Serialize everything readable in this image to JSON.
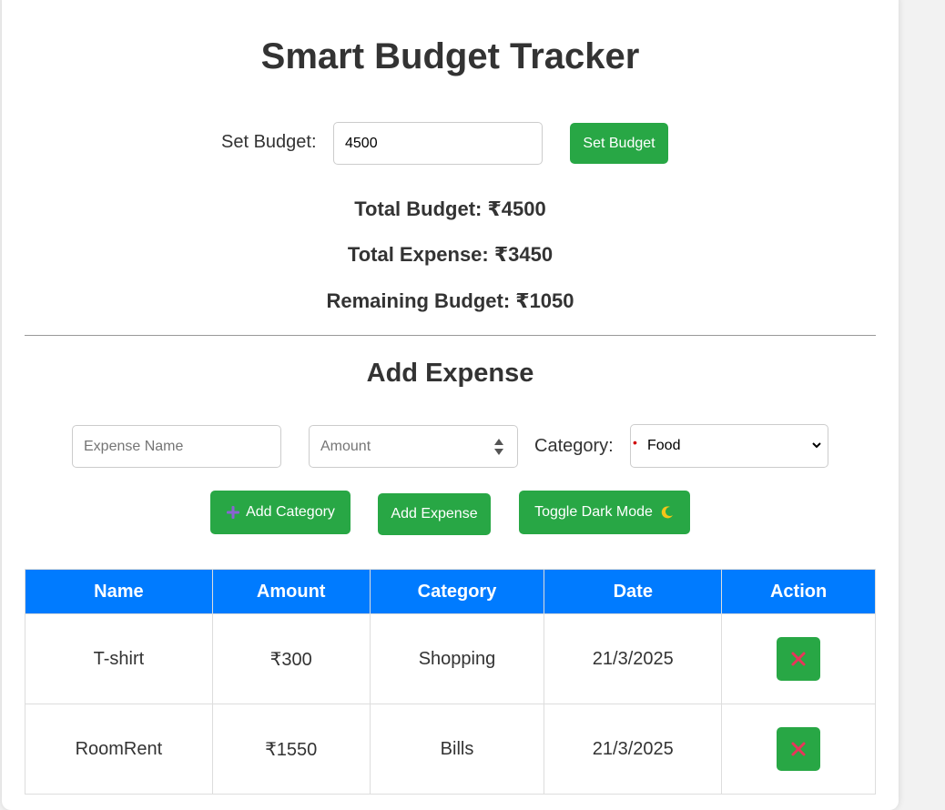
{
  "app": {
    "title": "Smart Budget Tracker"
  },
  "budget": {
    "label": "Set Budget:",
    "input_value": "4500",
    "button_label": "Set Budget"
  },
  "summary": {
    "total_budget": "Total Budget: ₹4500",
    "total_expense": "Total Expense: ₹3450",
    "remaining_budget": "Remaining Budget: ₹1050"
  },
  "add_expense": {
    "heading": "Add Expense",
    "name_placeholder": "Expense Name",
    "amount_placeholder": "Amount",
    "category_label": "Category:",
    "category_selected": "Food",
    "add_category_label": "Add Category",
    "add_expense_label": "Add Expense",
    "toggle_dark_label": "Toggle Dark Mode"
  },
  "table": {
    "headers": [
      "Name",
      "Amount",
      "Category",
      "Date",
      "Action"
    ],
    "rows": [
      {
        "name": "T-shirt",
        "amount": "₹300",
        "category": "Shopping",
        "date": "21/3/2025"
      },
      {
        "name": "RoomRent",
        "amount": "₹1550",
        "category": "Bills",
        "date": "21/3/2025"
      }
    ]
  },
  "colors": {
    "primary_button": "#28a745",
    "table_header": "#007bff",
    "delete_icon": "#e8355a",
    "plus_icon": "#8a63d2",
    "moon_icon": "#f5c518"
  },
  "icons": {
    "add_category": "plus-icon",
    "toggle_dark": "moon-icon",
    "delete": "close-icon"
  }
}
